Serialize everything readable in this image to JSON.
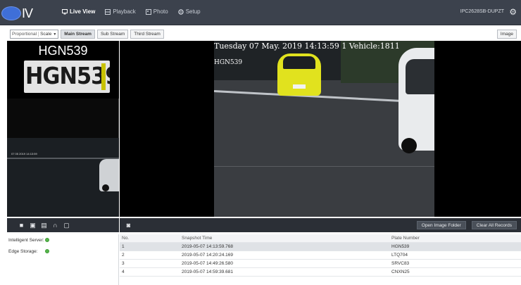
{
  "topbar": {
    "logo_text": "IV",
    "nav": [
      {
        "label": "Live View",
        "active": true
      },
      {
        "label": "Playback",
        "active": false
      },
      {
        "label": "Photo",
        "active": false
      },
      {
        "label": "Setup",
        "active": false
      }
    ],
    "device_name": "IPC2628SB-DUPZT"
  },
  "toolbar": {
    "ratio_label": "Proportional",
    "ratio_value": "Scale",
    "streams": [
      {
        "label": "Main Stream",
        "active": true
      },
      {
        "label": "Sub Stream",
        "active": false
      },
      {
        "label": "Third Stream",
        "active": false
      }
    ],
    "image_button": "Image"
  },
  "left_panel": {
    "plate_title": "HGN539",
    "plate_crop_text": "HGN539",
    "thumb_timestamp": "07 05 2019 14:13:59"
  },
  "video": {
    "osd_line1": "Tuesday 07 May. 2019 14:13:59 1 Vehicle:1811",
    "osd_line2": "HGN539"
  },
  "controls": {
    "open_folder": "Open Image Folder",
    "clear_records": "Clear All Records"
  },
  "status": [
    {
      "label": "Intelligent Server:",
      "ok": true
    },
    {
      "label": "Edge Storage:",
      "ok": true
    }
  ],
  "records": {
    "headers": [
      "No.",
      "Snapshot Time",
      "Plate Number"
    ],
    "rows": [
      {
        "no": "1",
        "time": "2019-05-07 14:13:59.768",
        "plate": "HGN539",
        "selected": true
      },
      {
        "no": "2",
        "time": "2019-05-07 14:20:24.169",
        "plate": "LTQ704",
        "selected": false
      },
      {
        "no": "3",
        "time": "2019-05-07 14:49:26.580",
        "plate": "SRVC83",
        "selected": false
      },
      {
        "no": "4",
        "time": "2019-05-07 14:59:39.681",
        "plate": "CNXN25",
        "selected": false
      }
    ]
  },
  "colors": {
    "topbar": "#3c424d",
    "accent": "#3f6fd8",
    "status_ok": "#55b54b"
  }
}
